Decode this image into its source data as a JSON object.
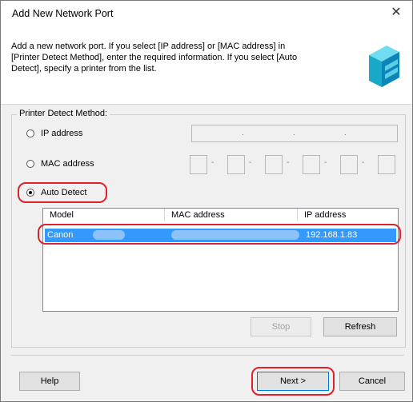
{
  "window": {
    "title": "Add New Network Port",
    "close_glyph": "✕"
  },
  "description": [
    "Add a new network port. If you select [IP address] or [MAC address] in",
    "[Printer Detect Method], enter the required information. If you select [Auto",
    "Detect], specify a printer from the list."
  ],
  "detect_group": {
    "label": "Printer Detect Method:",
    "options": [
      {
        "label": "IP address",
        "selected": false
      },
      {
        "label": "MAC address",
        "selected": false
      },
      {
        "label": "Auto Detect",
        "selected": true
      }
    ],
    "ip_separators": [
      ".",
      ".",
      "."
    ],
    "mac_separators": [
      "-",
      "-",
      "-",
      "-",
      "-"
    ]
  },
  "printer_list": {
    "columns": [
      "Model",
      "MAC address",
      "IP address"
    ],
    "rows": [
      {
        "model": "Canon",
        "mac": "",
        "ip": "192.168.1.83",
        "selected": true
      }
    ]
  },
  "buttons": {
    "stop": "Stop",
    "refresh": "Refresh",
    "help": "Help",
    "next": "Next >",
    "cancel": "Cancel"
  },
  "colors": {
    "highlight_ring": "#e0202a",
    "selection": "#3399ff",
    "dialog_bg": "#f0f0f0"
  },
  "icons": {
    "logo": "network-printer-icon"
  }
}
